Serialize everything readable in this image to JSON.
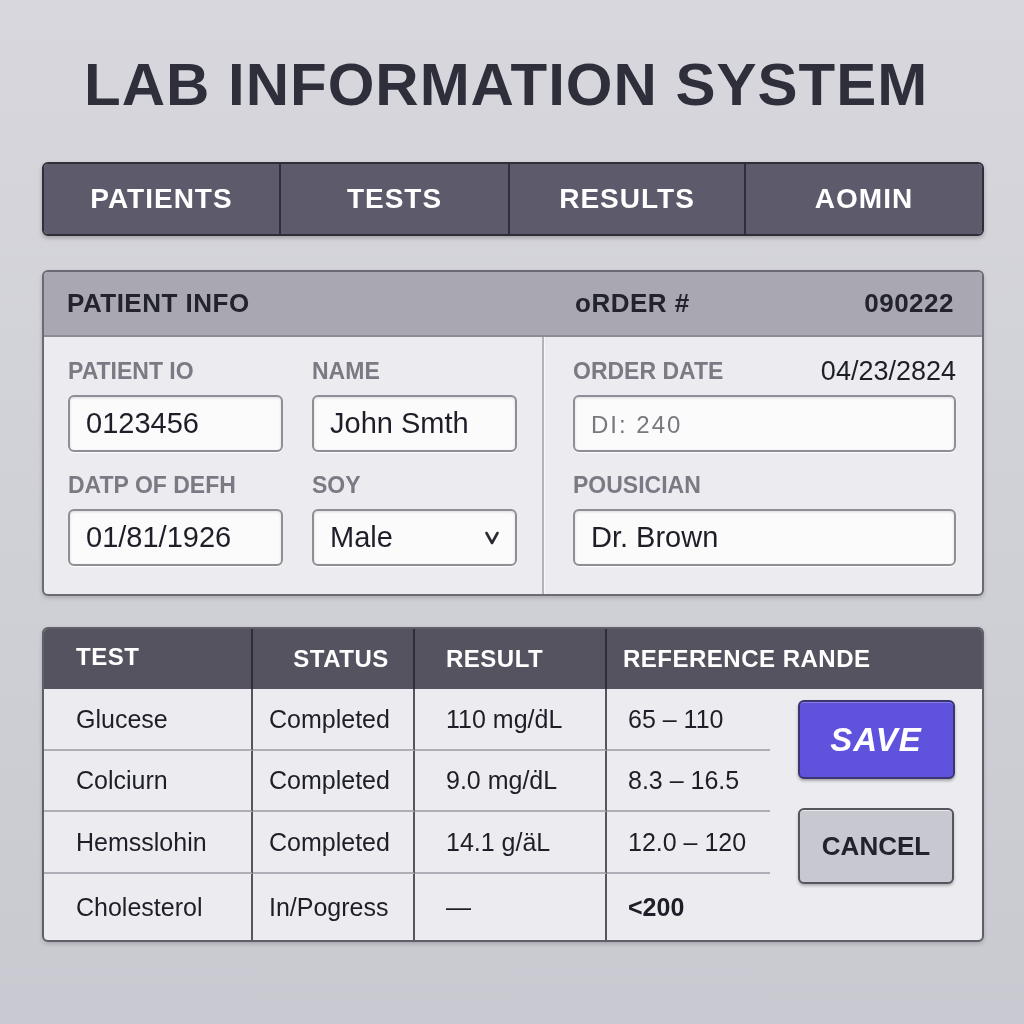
{
  "title": "LAB INFORMATION SYSTEM",
  "nav_tabs": [
    {
      "label": "PATIENTS"
    },
    {
      "label": "TESTS"
    },
    {
      "label": "RESULTS"
    },
    {
      "label": "AOMIN"
    }
  ],
  "patient_panel": {
    "title": "PATIENT INFO",
    "order_label": "oRDER #",
    "order_number": "090222",
    "patient_fields": [
      {
        "label": "PATIENT IO",
        "value": "0123456",
        "kind": "text"
      },
      {
        "label": "NAME",
        "value": "John Smth",
        "kind": "text"
      },
      {
        "label": "DATP OF DEFH",
        "value": "01/81/1926",
        "kind": "text"
      },
      {
        "label": "SOY",
        "value": "Male",
        "kind": "select"
      }
    ],
    "order_fields": [
      {
        "label": "ORDER DATE",
        "date": "04/23/2824",
        "placeholder": "DI: 240"
      },
      {
        "label": "POUSICIAN",
        "value": "Dr. Brown"
      }
    ]
  },
  "results_table": {
    "columns": [
      "TEST",
      "STATUS",
      "RESULT",
      "REFERENCE RANDE"
    ],
    "rows": [
      {
        "test": "Glucese",
        "status": "Completed",
        "result": "110 mg/ḋL",
        "reference": "65 – 110",
        "reference_emphasis": false
      },
      {
        "test": "Colciurn",
        "status": "Completed",
        "result": "9.0 mg/ḋL",
        "reference": "8.3 – 16.5",
        "reference_emphasis": false
      },
      {
        "test": "Hemsslohin",
        "status": "Completed",
        "result": "14.1 g/äL",
        "reference": "12.0 – 120",
        "reference_emphasis": false
      },
      {
        "test": "Cholesterol",
        "status": "In/Pogress",
        "result": "—",
        "reference": "<200",
        "reference_emphasis": true
      }
    ]
  },
  "buttons": [
    {
      "label": "SAVE",
      "kind": "primary"
    },
    {
      "label": "CANCEL",
      "kind": "secondary"
    }
  ]
}
